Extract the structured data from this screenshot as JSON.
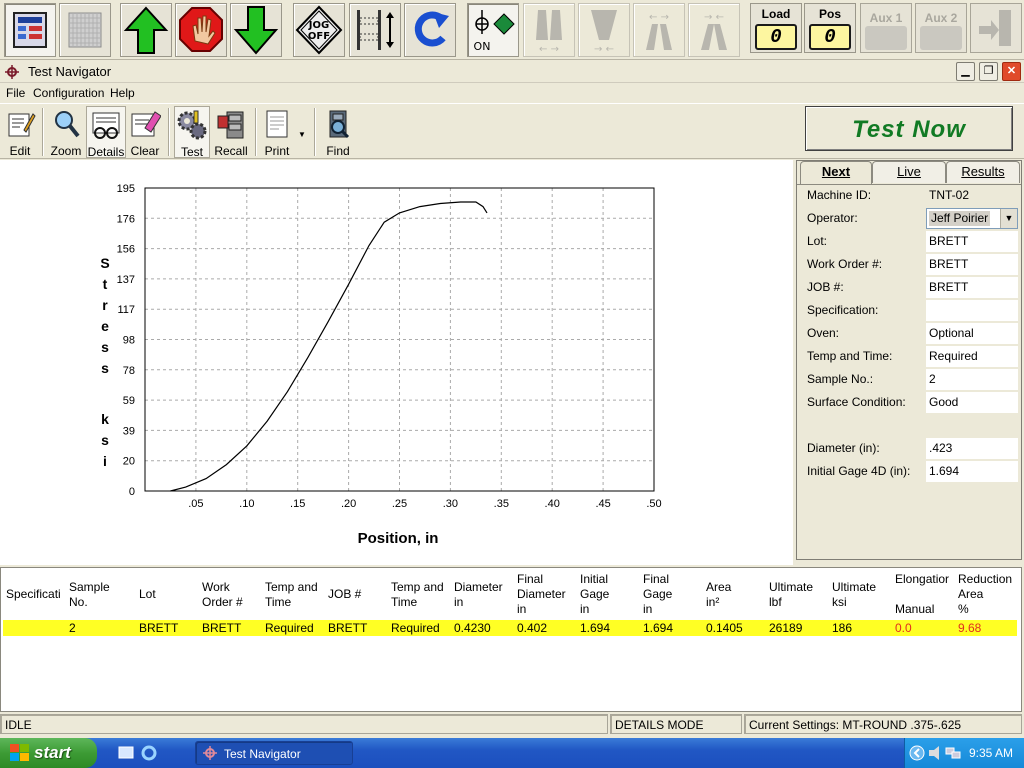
{
  "machine_toolbar": {
    "jog_label": "JOG OFF",
    "on_label": "ON",
    "load": {
      "label": "Load",
      "value": "0"
    },
    "pos": {
      "label": "Pos",
      "value": "0"
    },
    "aux1": {
      "label": "Aux 1"
    },
    "aux2": {
      "label": "Aux 2"
    }
  },
  "window": {
    "title": "Test Navigator"
  },
  "menu": [
    "File",
    "Configuration",
    "Help"
  ],
  "toolbar": {
    "edit": "Edit",
    "zoom": "Zoom",
    "details": "Details",
    "clear": "Clear",
    "test": "Test",
    "recall": "Recall",
    "print": "Print",
    "find": "Find",
    "test_now": "Test Now"
  },
  "chart_data": {
    "type": "line",
    "ylabel": "Stress ksi",
    "xlabel": "Position, in",
    "xlim": [
      0,
      0.5
    ],
    "ylim": [
      0,
      195
    ],
    "x_ticks": [
      ".05",
      ".10",
      ".15",
      ".20",
      ".25",
      ".30",
      ".35",
      ".40",
      ".45",
      ".50"
    ],
    "y_ticks": [
      "0",
      "20",
      "39",
      "59",
      "78",
      "98",
      "117",
      "137",
      "156",
      "176",
      "195"
    ],
    "grid": true,
    "series": [
      {
        "x": [
          0.025,
          0.04,
          0.06,
          0.08,
          0.1,
          0.12,
          0.14,
          0.16,
          0.18,
          0.2,
          0.22,
          0.235,
          0.25,
          0.27,
          0.29,
          0.31,
          0.325,
          0.332,
          0.336
        ],
        "y": [
          0,
          2.5,
          8,
          17,
          29,
          45,
          64,
          86,
          109,
          133,
          158,
          173,
          179,
          183,
          185,
          186,
          186,
          183,
          179
        ]
      }
    ]
  },
  "tabs": {
    "next": "Next",
    "live": "Live",
    "results": "Results"
  },
  "form": {
    "machine_id": {
      "label": "Machine ID:",
      "value": "TNT-02"
    },
    "operator": {
      "label": "Operator:",
      "value": "Jeff Poirier"
    },
    "lot": {
      "label": "Lot:",
      "value": "BRETT"
    },
    "work_order": {
      "label": "Work Order #:",
      "value": "BRETT"
    },
    "job": {
      "label": "JOB #:",
      "value": "BRETT"
    },
    "specification": {
      "label": "Specification:",
      "value": ""
    },
    "oven": {
      "label": "Oven:",
      "value": "Optional"
    },
    "temp_time": {
      "label": "Temp and Time:",
      "value": "Required"
    },
    "sample_no": {
      "label": "Sample No.:",
      "value": "2"
    },
    "surface": {
      "label": "Surface Condition:",
      "value": "Good"
    },
    "diameter": {
      "label": "Diameter (in):",
      "value": ".423"
    },
    "gage": {
      "label": "Initial Gage 4D (in):",
      "value": "1.694"
    }
  },
  "table": {
    "headers": [
      "Specificati",
      "Sample\nNo.",
      "Lot",
      "Work\nOrder #",
      "Temp and\nTime",
      "JOB #",
      "Temp and\nTime",
      "Diameter\nin",
      "Final\nDiameter\nin",
      "Initial\nGage\nin",
      "Final\nGage\nin",
      "Area\nin²",
      "Ultimate\nlbf",
      "Ultimate\nksi",
      "Elongatior\n\nManual",
      "Reduction\nArea\n%"
    ],
    "row": [
      "",
      "2",
      "BRETT",
      "BRETT",
      "Required",
      "BRETT",
      "Required",
      "0.4230",
      "0.402",
      "1.694",
      "1.694",
      "0.1405",
      "26189",
      "186",
      "0.0",
      "9.68"
    ]
  },
  "status": {
    "state": "IDLE",
    "mode": "DETAILS MODE",
    "settings": "Current Settings: MT-ROUND .375-.625"
  },
  "taskbar": {
    "start": "start",
    "task": "Test Navigator",
    "clock": "9:35 AM"
  }
}
